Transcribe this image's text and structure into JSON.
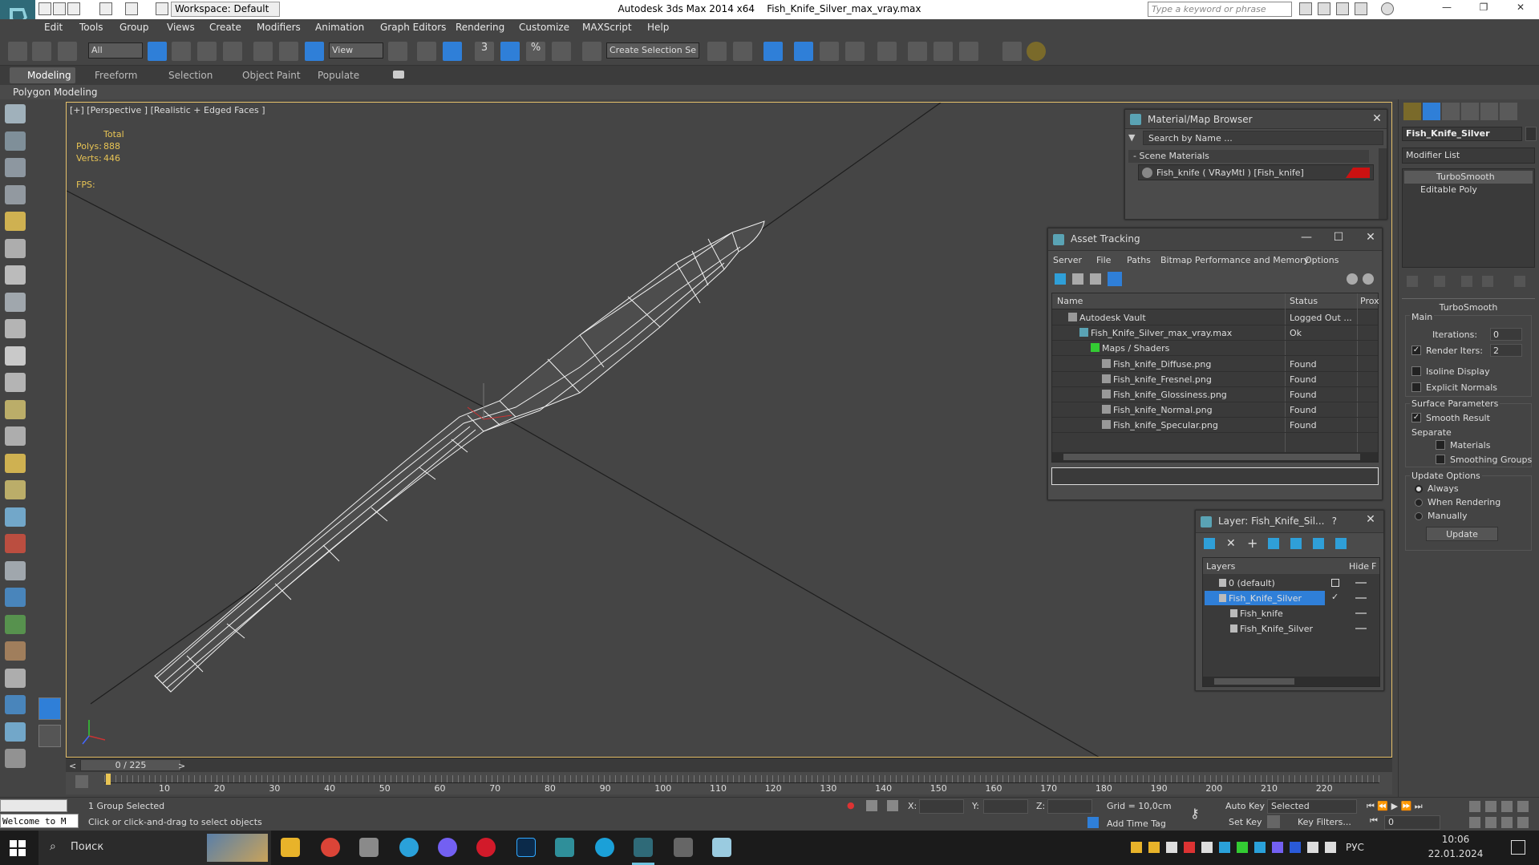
{
  "titlebar": {
    "app_title": "Autodesk 3ds Max  2014 x64",
    "file_name": "Fish_Knife_Silver_max_vray.max",
    "workspace": "Workspace: Default",
    "search_placeholder": "Type a keyword or phrase"
  },
  "menu": [
    "Edit",
    "Tools",
    "Group",
    "Views",
    "Create",
    "Modifiers",
    "Animation",
    "Graph Editors",
    "Rendering",
    "Customize",
    "MAXScript",
    "Help"
  ],
  "toolbar": {
    "selection_filter": "All",
    "ref_coord": "View",
    "named_selection": "Create Selection Se",
    "snap_3": "3",
    "percent": "%"
  },
  "ribbon": {
    "tabs": [
      "Modeling",
      "Freeform",
      "Selection",
      "Object Paint",
      "Populate"
    ],
    "active_panel": "Polygon Modeling"
  },
  "viewport": {
    "label": "[+] [Perspective ] [Realistic + Edged Faces ]",
    "stats_total": "Total",
    "polys_label": "Polys:",
    "polys_value": "888",
    "verts_label": "Verts:",
    "verts_value": "446",
    "fps_label": "FPS:"
  },
  "material_browser": {
    "title": "Material/Map Browser",
    "search_placeholder": "Search by Name ...",
    "section": "- Scene Materials",
    "material": "Fish_knife  ( VRayMtl ) [Fish_knife]",
    "material_color": "#cc1111"
  },
  "asset_tracking": {
    "title": "Asset Tracking",
    "menus": [
      "Server",
      "File",
      "Paths",
      "Bitmap Performance and Memory",
      "Options"
    ],
    "columns": [
      "Name",
      "Status",
      "Prox"
    ],
    "rows": [
      {
        "name": "Autodesk Vault",
        "status": "Logged Out ...",
        "indent": 0
      },
      {
        "name": "Fish_Knife_Silver_max_vray.max",
        "status": "Ok",
        "indent": 1
      },
      {
        "name": "Maps / Shaders",
        "status": "",
        "indent": 2
      },
      {
        "name": "Fish_knife_Diffuse.png",
        "status": "Found",
        "indent": 3
      },
      {
        "name": "Fish_knife_Fresnel.png",
        "status": "Found",
        "indent": 3
      },
      {
        "name": "Fish_knife_Glossiness.png",
        "status": "Found",
        "indent": 3
      },
      {
        "name": "Fish_knife_Normal.png",
        "status": "Found",
        "indent": 3
      },
      {
        "name": "Fish_knife_Specular.png",
        "status": "Found",
        "indent": 3
      }
    ]
  },
  "layer_panel": {
    "title": "Layer: Fish_Knife_Sil...",
    "help": "?",
    "columns": [
      "Layers",
      "Hide",
      "F"
    ],
    "rows": [
      {
        "name": "0 (default)",
        "indent": 0,
        "selected": false
      },
      {
        "name": "Fish_Knife_Silver",
        "indent": 0,
        "selected": true
      },
      {
        "name": "Fish_knife",
        "indent": 1,
        "selected": false
      },
      {
        "name": "Fish_Knife_Silver",
        "indent": 1,
        "selected": false
      }
    ]
  },
  "command_panel": {
    "object_name": "Fish_Knife_Silver",
    "modifier_list": "Modifier List",
    "stack": [
      "TurboSmooth",
      "Editable Poly"
    ],
    "rollout_title": "TurboSmooth",
    "main_group": "Main",
    "iterations_label": "Iterations:",
    "iterations_value": "0",
    "render_iters_label": "Render Iters:",
    "render_iters_value": "2",
    "isoline": "Isoline Display",
    "explicit_normals": "Explicit Normals",
    "surface_params": "Surface Parameters",
    "smooth_result": "Smooth Result",
    "separate": "Separate",
    "materials": "Materials",
    "smoothing_groups": "Smoothing Groups",
    "update_options": "Update Options",
    "always": "Always",
    "when_rendering": "When Rendering",
    "manually": "Manually",
    "update_button": "Update"
  },
  "timeline": {
    "frame_label": "0 / 225",
    "ticks": [
      "10",
      "20",
      "30",
      "40",
      "50",
      "60",
      "70",
      "80",
      "90",
      "100",
      "110",
      "120",
      "130",
      "140",
      "150",
      "160",
      "170",
      "180",
      "190",
      "200",
      "210",
      "220"
    ]
  },
  "status": {
    "listener": "Welcome to M",
    "selection": "1 Group Selected",
    "prompt": "Click or click-and-drag to select objects",
    "x_label": "X:",
    "y_label": "Y:",
    "z_label": "Z:",
    "grid": "Grid = 10,0cm",
    "add_time_tag": "Add Time Tag",
    "auto_key": "Auto Key",
    "set_key": "Set Key",
    "key_mode": "Selected",
    "key_filters": "Key Filters...",
    "frame_value": "0"
  },
  "taskbar": {
    "search": "Поиск",
    "lang": "РУС",
    "time": "10:06",
    "date": "22.01.2024"
  },
  "colors": {
    "accent_blue": "#2f7fd8",
    "viewport_border": "#e6c16b",
    "stats_yellow": "#e8c454"
  }
}
